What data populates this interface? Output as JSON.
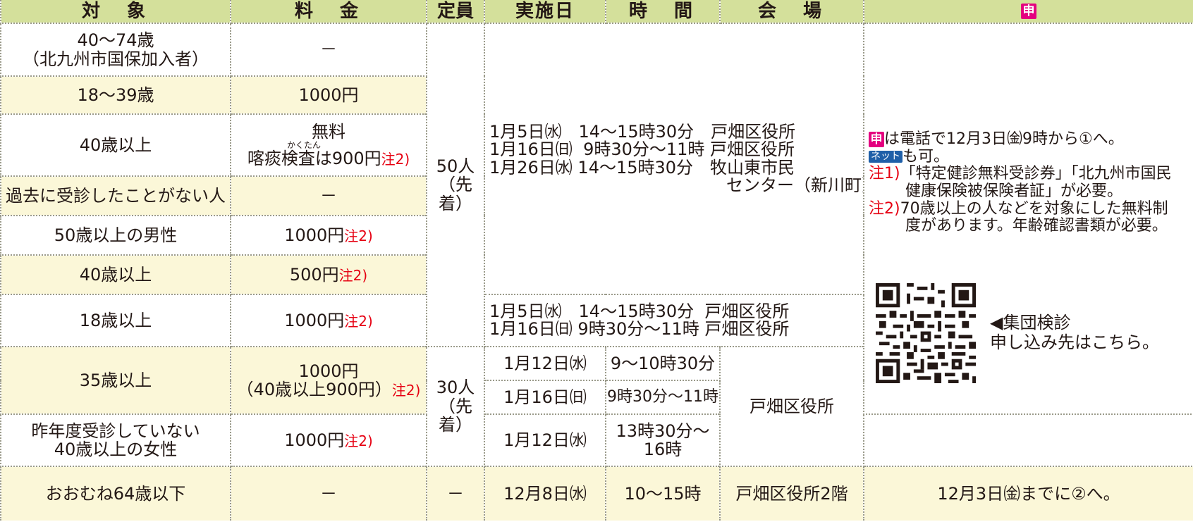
{
  "header": {
    "target": "対　象",
    "fee": "料　金",
    "capacity": "定員",
    "date": "実施日",
    "time": "時　間",
    "venue": "会　場",
    "apply_mark": "申"
  },
  "rows": [
    {
      "target_line1": "40～74歳",
      "target_line2": "（北九州市国保加入者）",
      "fee": "－"
    },
    {
      "target": "18～39歳",
      "fee": "1000円"
    },
    {
      "target": "40歳以上",
      "fee_line1": "無料",
      "ruby": "かくたん",
      "fee_line2": "喀痰検査は900円",
      "fee_note": "注2)"
    },
    {
      "target": "過去に受診したことがない人",
      "fee": "－"
    },
    {
      "target": "50歳以上の男性",
      "fee": "1000円",
      "fee_note": "注2)"
    },
    {
      "target": "40歳以上",
      "fee": "500円",
      "fee_note": "注2)"
    },
    {
      "target": "18歳以上",
      "fee": "1000円",
      "fee_note": "注2)"
    },
    {
      "target": "35歳以上",
      "fee_line1": "1000円",
      "fee_line2": "（40歳以上900円）",
      "fee_note": "注2)"
    },
    {
      "target_line1": "昨年度受診していない",
      "target_line2": "40歳以上の女性",
      "fee": "1000円",
      "fee_note": "注2)"
    },
    {
      "target": "おおむね64歳以下",
      "fee": "－",
      "capacity": "－",
      "date": "12月8日㈬",
      "time": "10～15時",
      "venue": "戸畑区役所2階",
      "apply": "12月3日㈮までに②へ。"
    }
  ],
  "capacity_a_line1": "50人",
  "capacity_a_line2": "（先着）",
  "capacity_b_line1": "30人",
  "capacity_b_line2": "（先着）",
  "schedule_a": "1月5日㈬　14～15時30分　戸畑区役所\n1月16日㈰  9時30分～11時 戸畑区役所\n1月26日㈬ 14～15時30分　牧山東市民\n　　　　　　　　　　　　　　センター（新川町）",
  "schedule_b": "1月5日㈬　14～15時30分  戸畑区役所\n1月16日㈰ 9時30分～11時 戸畑区役所",
  "group_b": [
    {
      "date": "1月12日㈬",
      "time": "9～10時30分"
    },
    {
      "date": "1月16日㈰",
      "time": "9時30分～11時"
    },
    {
      "date": "1月12日㈬",
      "time_line1": "13時30分～",
      "time_line2": "16時"
    }
  ],
  "venue_b": "戸畑区役所",
  "apply_box": {
    "mark": "申",
    "line1": "は電話で12月3日㈮9時から①へ。",
    "net_label": "ネット",
    "line2": "も可。",
    "note1_label": "注1)",
    "note1_line1": "「特定健診無料受診券」「北九州市国民",
    "note1_line2": "健康保険被保険者証」が必要。",
    "note2_label": "注2)",
    "note2_line1": "70歳以上の人などを対象にした無料制",
    "note2_line2": "度があります。年齢確認書類が必要。",
    "qr_line1": "◀集団検診",
    "qr_line2": "申し込み先はこちら。"
  },
  "colors": {
    "header": "#d4e09b",
    "cream": "#fbf7d8",
    "note_red": "#e60012",
    "apply_magenta": "#e4007f",
    "net_blue": "#1f5fa8"
  }
}
